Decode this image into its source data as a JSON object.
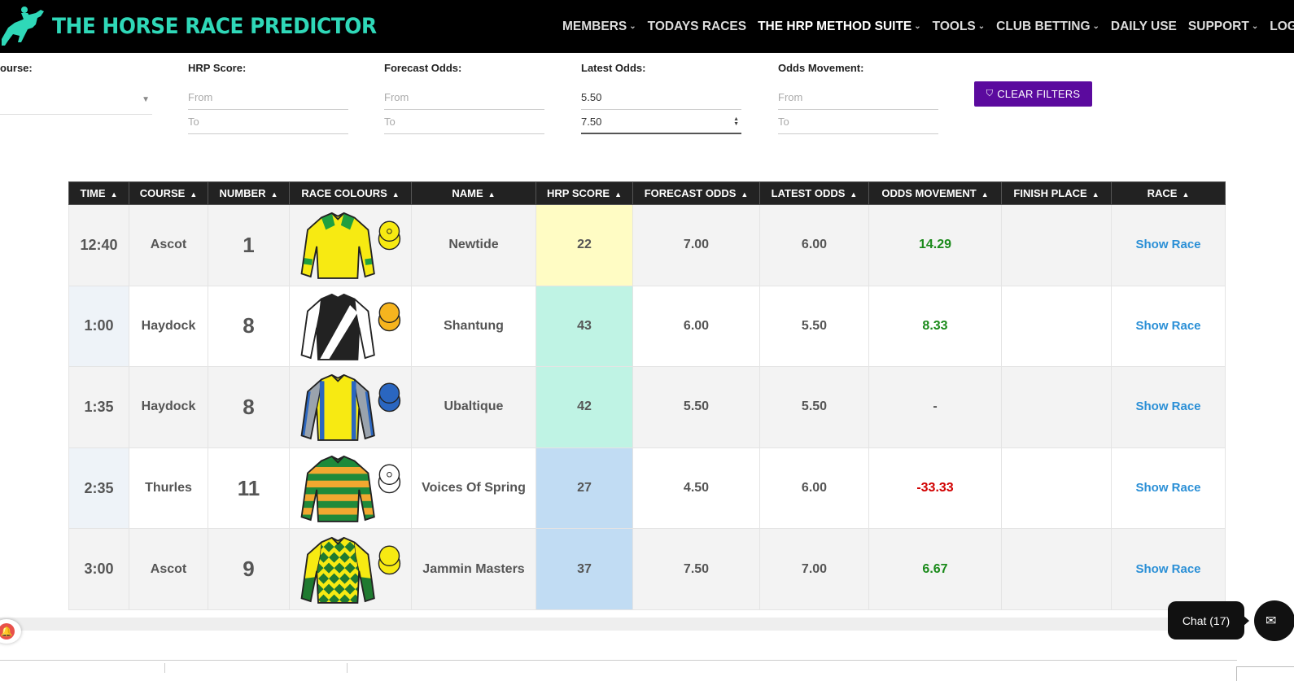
{
  "brand": {
    "name": "THE HORSE RACE PREDICTOR"
  },
  "nav": [
    {
      "label": "MEMBERS",
      "dropdown": true
    },
    {
      "label": "TODAYS RACES",
      "dropdown": false
    },
    {
      "label": "THE HRP METHOD SUITE",
      "dropdown": true,
      "active": true
    },
    {
      "label": "TOOLS",
      "dropdown": true
    },
    {
      "label": "CLUB BETTING",
      "dropdown": true
    },
    {
      "label": "DAILY USE",
      "dropdown": false
    },
    {
      "label": "SUPPORT",
      "dropdown": true
    },
    {
      "label": "LOGO",
      "dropdown": false
    }
  ],
  "filters": {
    "course": {
      "label": "ourse:",
      "value": ""
    },
    "hrp_score": {
      "label": "HRP Score:",
      "from_placeholder": "From",
      "to_placeholder": "To",
      "from": "",
      "to": ""
    },
    "forecast_odds": {
      "label": "Forecast Odds:",
      "from_placeholder": "From",
      "to_placeholder": "To",
      "from": "",
      "to": ""
    },
    "latest_odds": {
      "label": "Latest Odds:",
      "from_placeholder": "From",
      "to_placeholder": "To",
      "from": "5.50",
      "to": "7.50"
    },
    "odds_movement": {
      "label": "Odds Movement:",
      "from_placeholder": "From",
      "to_placeholder": "To",
      "from": "",
      "to": ""
    },
    "clear_button": "CLEAR FILTERS"
  },
  "table": {
    "headers": [
      "TIME",
      "COURSE",
      "NUMBER",
      "RACE COLOURS",
      "NAME",
      "HRP SCORE",
      "FORECAST ODDS",
      "LATEST ODDS",
      "ODDS MOVEMENT",
      "FINISH PLACE",
      "RACE"
    ],
    "rows": [
      {
        "time": "12:40",
        "course": "Ascot",
        "number": "1",
        "silks": "yellow-green-shoulders",
        "name": "Newtide",
        "hrp": "22",
        "hrp_color": "#fffcc4",
        "forecast": "7.00",
        "latest": "6.00",
        "movement": "14.29",
        "movement_dir": "pos",
        "finish": "",
        "race": "Show Race"
      },
      {
        "time": "1:00",
        "course": "Haydock",
        "number": "8",
        "silks": "black-white-sash",
        "name": "Shantung",
        "hrp": "43",
        "hrp_color": "#bff3e4",
        "forecast": "6.00",
        "latest": "5.50",
        "movement": "8.33",
        "movement_dir": "pos",
        "finish": "",
        "race": "Show Race"
      },
      {
        "time": "1:35",
        "course": "Haydock",
        "number": "8",
        "silks": "yellow-blue-braces",
        "name": "Ubaltique",
        "hrp": "42",
        "hrp_color": "#bff3e4",
        "forecast": "5.50",
        "latest": "5.50",
        "movement": "-",
        "movement_dir": "none",
        "finish": "",
        "race": "Show Race"
      },
      {
        "time": "2:35",
        "course": "Thurles",
        "number": "11",
        "silks": "green-orange-hoops",
        "name": "Voices Of Spring",
        "hrp": "27",
        "hrp_color": "#c1dcf3",
        "forecast": "4.50",
        "latest": "6.00",
        "movement": "-33.33",
        "movement_dir": "neg",
        "finish": "",
        "race": "Show Race"
      },
      {
        "time": "3:00",
        "course": "Ascot",
        "number": "9",
        "silks": "yellow-green-diamonds",
        "name": "Jammin Masters",
        "hrp": "37",
        "hrp_color": "#c1dcf3",
        "forecast": "7.50",
        "latest": "7.00",
        "movement": "6.67",
        "movement_dir": "pos",
        "finish": "",
        "race": "Show Race"
      }
    ]
  },
  "chat": {
    "label": "Chat (17)"
  },
  "colors": {
    "brand": "#2fd8b8",
    "clear_button": "#5b0a9e",
    "link": "#2a8fd6",
    "positive": "#1a8a1a",
    "negative": "#d10000"
  }
}
